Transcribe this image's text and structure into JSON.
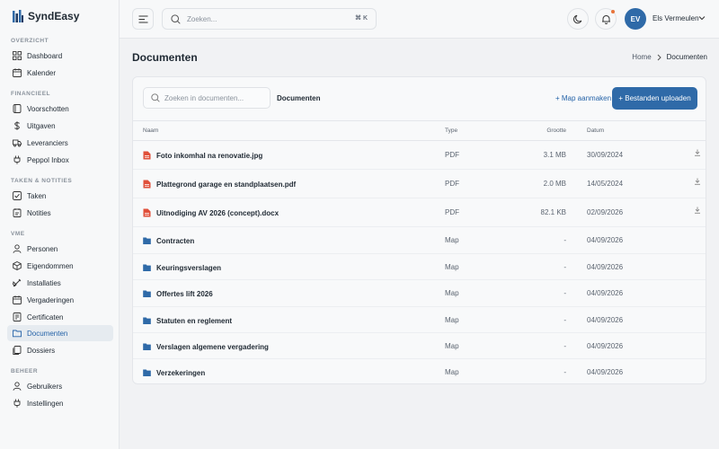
{
  "app": {
    "name": "SyndEasy"
  },
  "sidebar": {
    "sections": [
      {
        "label": "OVERZICHT",
        "items": [
          {
            "label": "Dashboard",
            "icon": "grid-icon"
          },
          {
            "label": "Kalender",
            "icon": "calendar-icon"
          }
        ]
      },
      {
        "label": "FINANCIEEL",
        "items": [
          {
            "label": "Voorschotten",
            "icon": "wallet-icon"
          },
          {
            "label": "Uitgaven",
            "icon": "dollar-icon"
          },
          {
            "label": "Leveranciers",
            "icon": "truck-icon"
          },
          {
            "label": "Peppol Inbox",
            "icon": "plug-icon"
          }
        ]
      },
      {
        "label": "TAKEN & NOTITIES",
        "items": [
          {
            "label": "Taken",
            "icon": "checkbox-icon"
          },
          {
            "label": "Notities",
            "icon": "note-icon"
          }
        ]
      },
      {
        "label": "VME",
        "items": [
          {
            "label": "Personen",
            "icon": "person-icon"
          },
          {
            "label": "Eigendommen",
            "icon": "cube-icon"
          },
          {
            "label": "Installaties",
            "icon": "tools-icon"
          },
          {
            "label": "Vergaderingen",
            "icon": "calendar-icon"
          },
          {
            "label": "Certificaten",
            "icon": "certificate-icon"
          },
          {
            "label": "Documenten",
            "icon": "folder-icon",
            "active": true
          },
          {
            "label": "Dossiers",
            "icon": "dossier-icon"
          }
        ]
      },
      {
        "label": "BEHEER",
        "items": [
          {
            "label": "Gebruikers",
            "icon": "person-icon"
          },
          {
            "label": "Instellingen",
            "icon": "settings-icon"
          }
        ]
      }
    ]
  },
  "header": {
    "search_placeholder": "Zoeken...",
    "search_shortcut": "⌘ K",
    "user": {
      "initials": "EV",
      "name": "Els Vermeulen"
    }
  },
  "page": {
    "title": "Documenten",
    "breadcrumb": [
      "Home",
      "Documenten"
    ]
  },
  "toolbar": {
    "search_placeholder": "Zoeken in documenten...",
    "current_folder": "Documenten",
    "new_folder_label": "+ Map aanmaken",
    "upload_label": "+ Bestanden uploaden"
  },
  "table": {
    "columns": {
      "name": "Naam",
      "type": "Type",
      "size": "Grootte",
      "date": "Datum"
    },
    "rows": [
      {
        "kind": "file",
        "name": "Foto inkomhal na renovatie.jpg",
        "type": "PDF",
        "size": "3.1 MB",
        "date": "30/09/2024"
      },
      {
        "kind": "file",
        "name": "Plattegrond garage en standplaatsen.pdf",
        "type": "PDF",
        "size": "2.0 MB",
        "date": "14/05/2024"
      },
      {
        "kind": "file",
        "name": "Uitnodiging AV 2026 (concept).docx",
        "type": "PDF",
        "size": "82.1 KB",
        "date": "02/09/2026"
      },
      {
        "kind": "folder",
        "name": "Contracten",
        "type": "Map",
        "size": "-",
        "date": "04/09/2026"
      },
      {
        "kind": "folder",
        "name": "Keuringsverslagen",
        "type": "Map",
        "size": "-",
        "date": "04/09/2026"
      },
      {
        "kind": "folder",
        "name": "Offertes lift 2026",
        "type": "Map",
        "size": "-",
        "date": "04/09/2026"
      },
      {
        "kind": "folder",
        "name": "Statuten en reglement",
        "type": "Map",
        "size": "-",
        "date": "04/09/2026"
      },
      {
        "kind": "folder",
        "name": "Verslagen algemene vergadering",
        "type": "Map",
        "size": "-",
        "date": "04/09/2026"
      },
      {
        "kind": "folder",
        "name": "Verzekeringen",
        "type": "Map",
        "size": "-",
        "date": "04/09/2026"
      }
    ]
  },
  "colors": {
    "accent": "#2f6aa8",
    "file_icon": "#e0503a",
    "folder_icon": "#2f6aa8",
    "notification_dot": "#e8743b"
  }
}
